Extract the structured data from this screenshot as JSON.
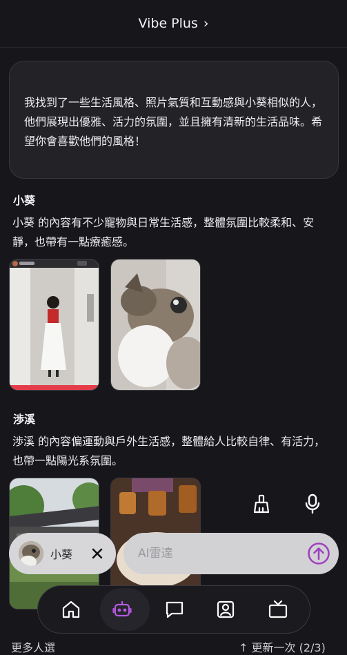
{
  "header": {
    "title": "Vibe Plus",
    "chevron": "chevron-right-icon"
  },
  "ai_message": "我找到了一些生活風格、照片氣質和互動感與小葵相似的人，他們展現出優雅、活力的氛圍，並且擁有清新的生活品味。希望你會喜歡他們的風格！",
  "profiles": [
    {
      "name": "小葵",
      "description": "小葵 的內容有不少寵物與日常生活感，整體氛圍比較柔和、安靜，也帶有一點療癒感。"
    },
    {
      "name": "渉溪",
      "description": "渉溪 的內容偏運動與戶外生活感，整體給人比較自律、有活力，也帶一點陽光系氛圍。"
    }
  ],
  "floating_actions": {
    "clear_icon": "broom-icon",
    "mic_icon": "microphone-icon"
  },
  "selected_chip": {
    "label": "小葵"
  },
  "input": {
    "placeholder": "AI雷達"
  },
  "nav": [
    "home-icon",
    "robot-icon",
    "chat-icon",
    "contact-icon",
    "tv-icon"
  ],
  "colors": {
    "accent": "#a040c0",
    "background": "#17161b",
    "active_nav": "#b55ae0"
  },
  "peek": {
    "left": "更多人選",
    "right": "↑ 更新一次 (2/3)"
  }
}
